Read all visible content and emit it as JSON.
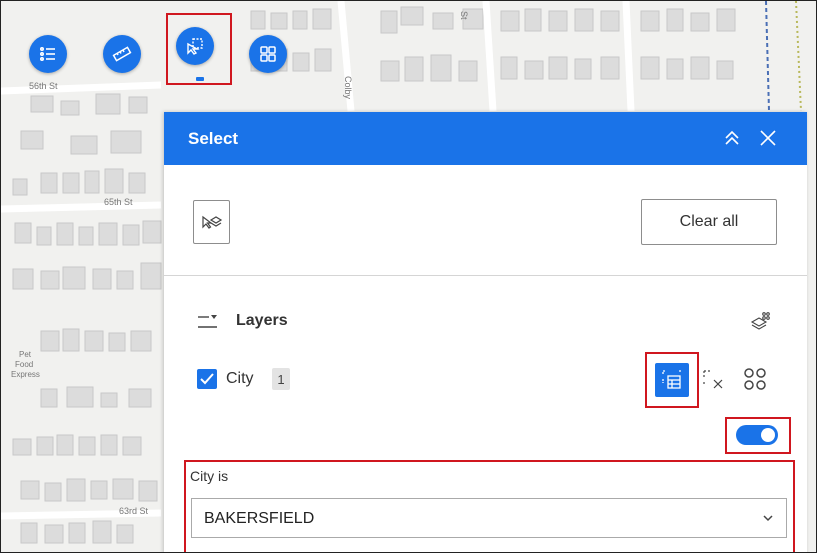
{
  "map": {
    "street_labels": [
      "56th St",
      "65th St",
      "63rd St",
      "Colby",
      "St"
    ],
    "poi_label": [
      "Pet",
      "Food",
      "Express"
    ]
  },
  "toolbar": {
    "items": [
      {
        "icon": "list-icon",
        "active": false
      },
      {
        "icon": "ruler-icon",
        "active": false
      },
      {
        "icon": "select-tool-icon",
        "active": true
      },
      {
        "icon": "grid-icon",
        "active": false
      }
    ]
  },
  "panel": {
    "title": "Select",
    "collapse_icon": "chevrons-up-icon",
    "close_icon": "close-icon",
    "select_tool_icon": "select-layers-icon",
    "clear_all_label": "Clear all",
    "layers": {
      "label": "Layers",
      "items": [
        {
          "name": "City",
          "checked": true,
          "selected_count": "1"
        }
      ]
    },
    "filter": {
      "enabled": true,
      "label": "City is",
      "value": "BAKERSFIELD"
    }
  },
  "colors": {
    "accent": "#1a73e8",
    "highlight": "#d0171f"
  }
}
